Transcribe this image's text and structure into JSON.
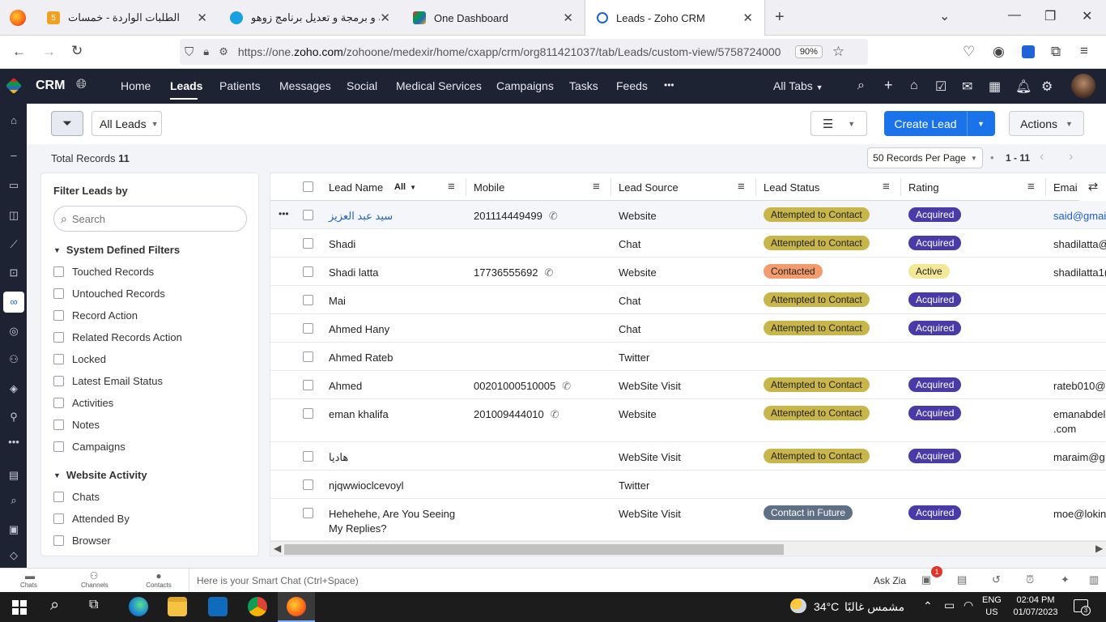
{
  "browser": {
    "tabs": [
      {
        "title": "الطلبات الواردة - خمسات",
        "fav": "5"
      },
      {
        "title": "تهيئة و برمجة و تعديل برنامج زوهو",
        "fav": ""
      },
      {
        "title": "One Dashboard",
        "fav": ""
      },
      {
        "title": "Leads - Zoho CRM",
        "fav": ""
      }
    ],
    "url_prefix": "https://one.",
    "url_domain": "zoho.com",
    "url_rest": "/zohoone/medexir/home/cxapp/crm/org811421037/tab/Leads/custom-view/5758724000",
    "zoom": "90%"
  },
  "crm": {
    "app_name": "CRM",
    "modules": [
      "Home",
      "Leads",
      "Patients",
      "Messages",
      "Social",
      "Medical Services",
      "Campaigns",
      "Tasks",
      "Feeds"
    ],
    "more": "•••",
    "all_tabs": "All Tabs"
  },
  "toolbar": {
    "view_select": "All Leads",
    "create_lead": "Create Lead",
    "actions": "Actions"
  },
  "records": {
    "total_label": "Total Records",
    "total_count": "11",
    "per_page": "50 Records Per Page",
    "range": "1 - 11"
  },
  "filter_panel": {
    "title": "Filter Leads by",
    "search_placeholder": "Search",
    "system_section": "System Defined Filters",
    "system_items": [
      "Touched Records",
      "Untouched Records",
      "Record Action",
      "Related Records Action",
      "Locked",
      "Latest Email Status",
      "Activities",
      "Notes",
      "Campaigns"
    ],
    "website_section": "Website Activity",
    "website_items": [
      "Chats",
      "Attended By",
      "Browser"
    ]
  },
  "table": {
    "columns": {
      "lead_name": "Lead Name",
      "all": "All",
      "mobile": "Mobile",
      "lead_source": "Lead Source",
      "lead_status": "Lead Status",
      "rating": "Rating",
      "email": "Emai"
    },
    "rows": [
      {
        "name": "سيد عبد العزيز",
        "mobile": "201114449499",
        "source": "Website",
        "status": "Attempted to Contact",
        "status_kind": "att",
        "rating": "Acquired",
        "rating_kind": "acq",
        "email": "said@gmai",
        "link": true
      },
      {
        "name": "Shadi",
        "mobile": "",
        "source": "Chat",
        "status": "Attempted to Contact",
        "status_kind": "att",
        "rating": "Acquired",
        "rating_kind": "acq",
        "email": "shadilatta@"
      },
      {
        "name": "Shadi latta",
        "mobile": "17736555692",
        "source": "Website",
        "status": "Contacted",
        "status_kind": "con",
        "rating": "Active",
        "rating_kind": "act",
        "email": "shadilatta1("
      },
      {
        "name": "Mai",
        "mobile": "",
        "source": "Chat",
        "status": "Attempted to Contact",
        "status_kind": "att",
        "rating": "Acquired",
        "rating_kind": "acq",
        "email": ""
      },
      {
        "name": "Ahmed Hany",
        "mobile": "",
        "source": "Chat",
        "status": "Attempted to Contact",
        "status_kind": "att",
        "rating": "Acquired",
        "rating_kind": "acq",
        "email": ""
      },
      {
        "name": "Ahmed Rateb",
        "mobile": "",
        "source": "Twitter",
        "status": "",
        "status_kind": "",
        "rating": "",
        "rating_kind": "",
        "email": ""
      },
      {
        "name": "Ahmed",
        "mobile": "00201000510005",
        "source": "WebSite Visit",
        "status": "Attempted to Contact",
        "status_kind": "att",
        "rating": "Acquired",
        "rating_kind": "acq",
        "email": "rateb010@"
      },
      {
        "name": "eman khalifa",
        "mobile": "201009444010",
        "source": "Website",
        "status": "Attempted to Contact",
        "status_kind": "att",
        "rating": "Acquired",
        "rating_kind": "acq",
        "email": "emanabdel",
        "email2": ".com"
      },
      {
        "name": "هاديا",
        "mobile": "",
        "source": "WebSite Visit",
        "status": "Attempted to Contact",
        "status_kind": "att",
        "rating": "Acquired",
        "rating_kind": "acq",
        "email": "maraim@g"
      },
      {
        "name": "njqwwioclcevoyl",
        "mobile": "",
        "source": "Twitter",
        "status": "",
        "status_kind": "",
        "rating": "",
        "rating_kind": "",
        "email": ""
      },
      {
        "name": "Hehehehe, Are You Seeing",
        "name2": "My Replies?",
        "mobile": "",
        "source": "WebSite Visit",
        "status": "Contact in Future",
        "status_kind": "fut",
        "rating": "Acquired",
        "rating_kind": "acq",
        "email": "moe@lokin"
      }
    ]
  },
  "bottom": {
    "chats": "Chats",
    "channels": "Channels",
    "contacts": "Contacts",
    "smart_chat": "Here is your Smart Chat (Ctrl+Space)",
    "ask_zia": "Ask Zia",
    "notif_count": "1"
  },
  "taskbar": {
    "temp": "34°C",
    "weather": "مشمس غالبًا",
    "lang1": "ENG",
    "lang2": "US",
    "time": "02:04 PM",
    "date": "01/07/2023",
    "notif": "3"
  }
}
